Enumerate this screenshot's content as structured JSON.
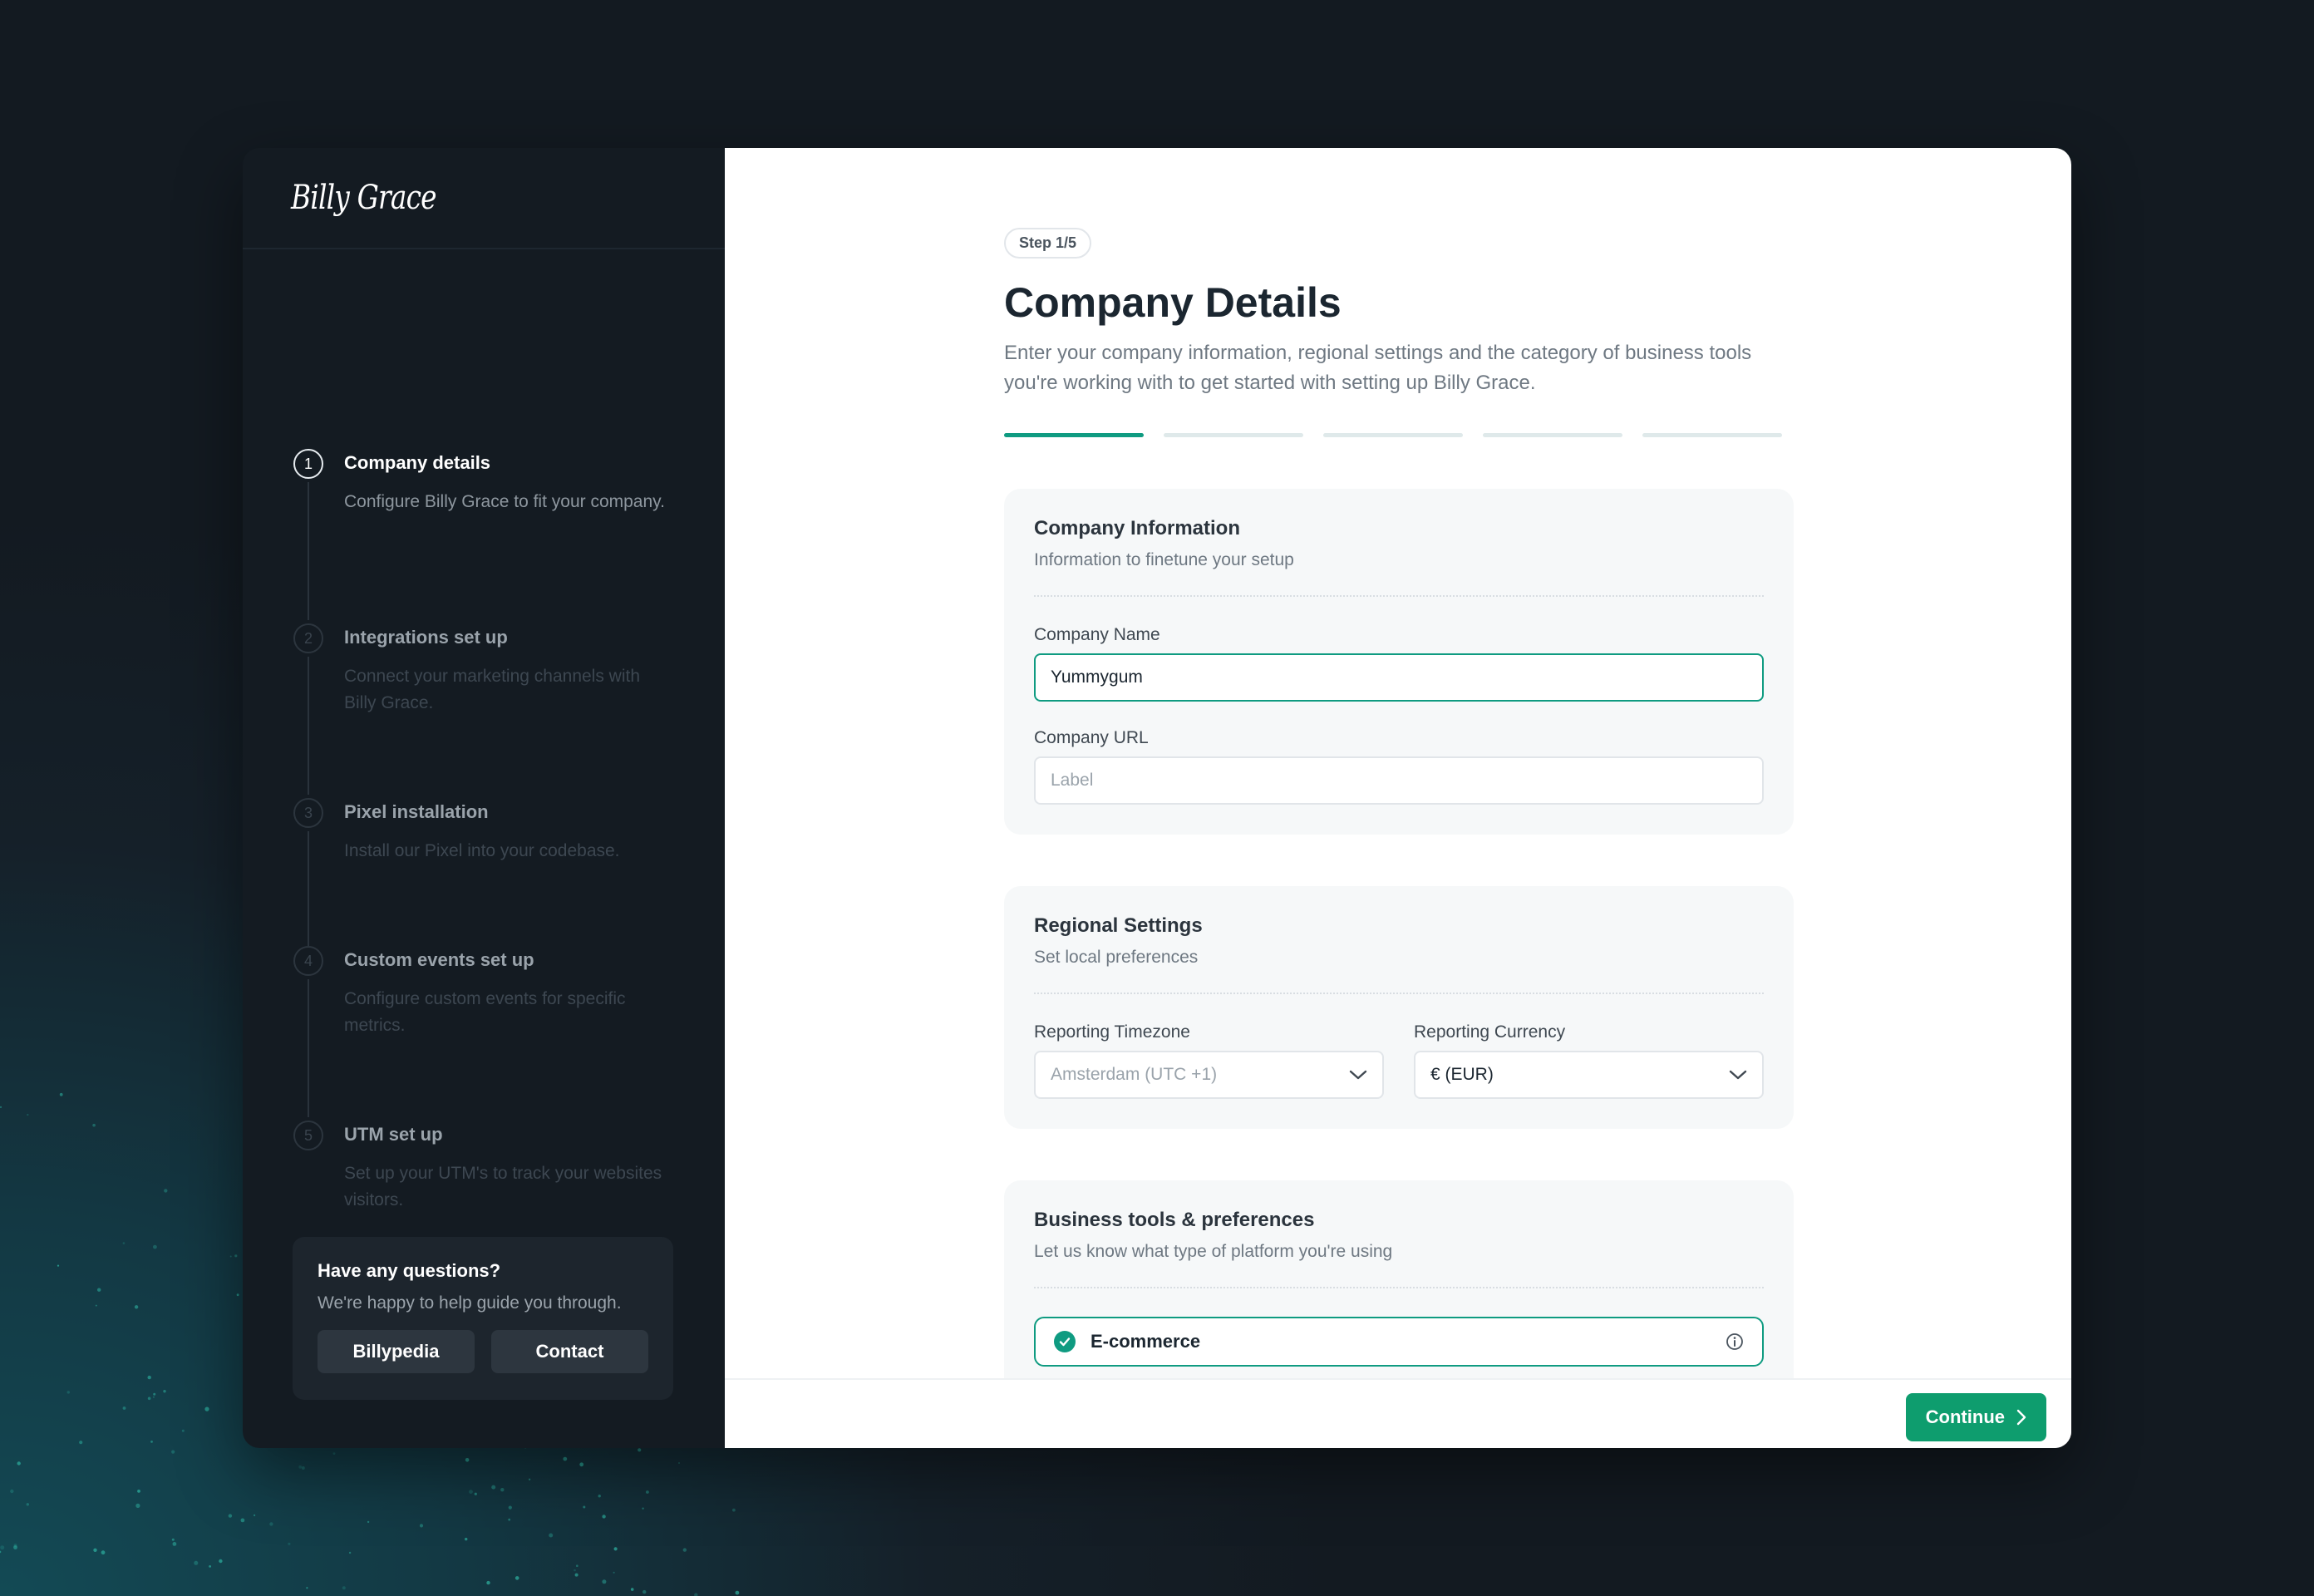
{
  "brand": {
    "logo_text": "Billy Grace"
  },
  "sidebar": {
    "steps": [
      {
        "number": "1",
        "title": "Company details",
        "description": "Configure Billy Grace to fit your company.",
        "state": "active"
      },
      {
        "number": "2",
        "title": "Integrations set up",
        "description": "Connect your marketing channels with Billy Grace.",
        "state": "inactive"
      },
      {
        "number": "3",
        "title": "Pixel installation",
        "description": "Install our Pixel into your codebase.",
        "state": "inactive"
      },
      {
        "number": "4",
        "title": "Custom events set up",
        "description": "Configure custom events for specific metrics.",
        "state": "inactive"
      },
      {
        "number": "5",
        "title": "UTM set up",
        "description": "Set up your UTM's to track your websites visitors.",
        "state": "inactive"
      }
    ],
    "help": {
      "title": "Have any questions?",
      "text": "We're happy to help guide you through.",
      "billypedia_label": "Billypedia",
      "contact_label": "Contact"
    }
  },
  "main": {
    "step_badge": "Step 1/5",
    "title": "Company Details",
    "description": "Enter your company information, regional settings and the category of business tools you're working with to get started with setting up Billy Grace.",
    "progress": {
      "current": 1,
      "total": 5
    },
    "company_info": {
      "title": "Company Information",
      "subtitle": "Information to finetune your setup",
      "name_label": "Company Name",
      "name_value": "Yummygum",
      "url_label": "Company URL",
      "url_placeholder": "Label"
    },
    "regional": {
      "title": "Regional Settings",
      "subtitle": "Set local preferences",
      "timezone_label": "Reporting Timezone",
      "timezone_value": "Amsterdam (UTC +1)",
      "currency_label": "Reporting Currency",
      "currency_value": "€ (EUR)"
    },
    "business": {
      "title": "Business tools & preferences",
      "subtitle": "Let us know what type of platform you're using",
      "option_label": "E-commerce",
      "option_selected": true
    },
    "continue_label": "Continue"
  },
  "colors": {
    "accent": "#0f9b81",
    "button": "#0e9d6e",
    "sidebar_bg": "#141b22"
  },
  "icons": [
    "check-icon",
    "info-icon",
    "chevron-down-icon",
    "chevron-right-icon"
  ]
}
